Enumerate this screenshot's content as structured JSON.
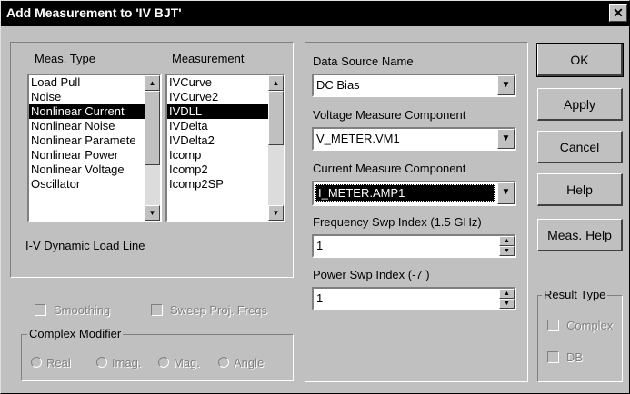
{
  "title": "Add Measurement to 'IV BJT'",
  "close_glyph": "✕",
  "meas_type": {
    "label": "Meas. Type",
    "items": [
      "Load Pull",
      "Noise",
      "Nonlinear Current",
      "Nonlinear Noise",
      "Nonlinear Paramete",
      "Nonlinear Power",
      "Nonlinear Voltage",
      "Oscillator"
    ],
    "selected_index": 2
  },
  "measurement": {
    "label": "Measurement",
    "items": [
      "IVCurve",
      "IVCurve2",
      "IVDLL",
      "IVDelta",
      "IVDelta2",
      "Icomp",
      "Icomp2",
      "Icomp2SP"
    ],
    "selected_index": 2
  },
  "description": "I-V Dynamic Load Line",
  "smoothing_label": "Smoothing",
  "sweep_proj_freqs_label": "Sweep Proj. Freqs",
  "complex_modifier": {
    "label": "Complex Modifier",
    "options": [
      "Real",
      "Imag.",
      "Mag.",
      "Angle"
    ]
  },
  "data_source": {
    "label": "Data Source Name",
    "value": "DC Bias"
  },
  "voltage_component": {
    "label": "Voltage Measure Component",
    "value": "V_METER.VM1"
  },
  "current_component": {
    "label": "Current Measure Component",
    "value": "I_METER.AMP1"
  },
  "freq_swp": {
    "label": "Frequency Swp Index (1.5 GHz)",
    "value": "1"
  },
  "power_swp": {
    "label": "Power Swp Index (-7 )",
    "value": "1"
  },
  "buttons": {
    "ok": "OK",
    "apply": "Apply",
    "cancel": "Cancel",
    "help": "Help",
    "meas_help": "Meas. Help"
  },
  "result_type": {
    "label": "Result Type",
    "complex": "Complex",
    "db": "DB"
  }
}
